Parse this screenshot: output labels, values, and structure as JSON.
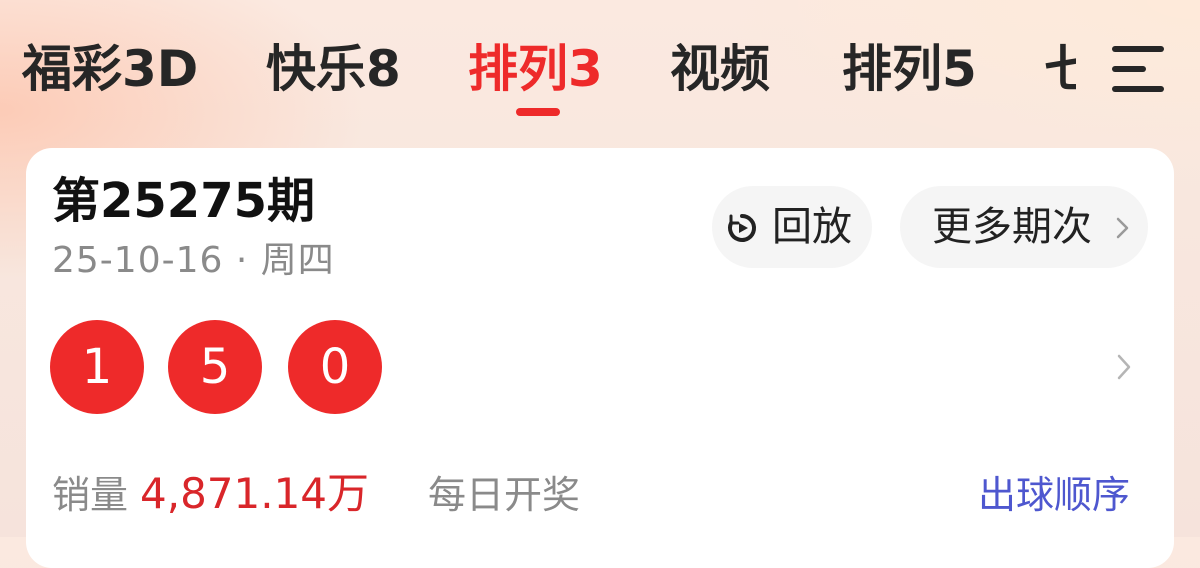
{
  "tabs": [
    {
      "label": "福彩3D",
      "active": false
    },
    {
      "label": "快乐8",
      "active": false
    },
    {
      "label": "排列3",
      "active": true
    },
    {
      "label": "视频",
      "active": false
    },
    {
      "label": "排列5",
      "active": false
    },
    {
      "label": "七",
      "active": false
    }
  ],
  "menu_icon": "hamburger-menu-icon",
  "draw": {
    "issue": "第25275期",
    "date": "25-10-16 · 周四",
    "numbers": [
      "1",
      "5",
      "0"
    ],
    "replay_label": "回放",
    "more_label": "更多期次",
    "sales_label": "销量",
    "sales_value": "4,871.14万",
    "draw_frequency": "每日开奖",
    "order_link": "出球顺序"
  },
  "colors": {
    "accent_red": "#ee2a2a",
    "ball_red": "#ee2a2a",
    "link_blue": "#4e57cf",
    "text_dark": "#262626",
    "text_gray": "#8a8a8a"
  }
}
